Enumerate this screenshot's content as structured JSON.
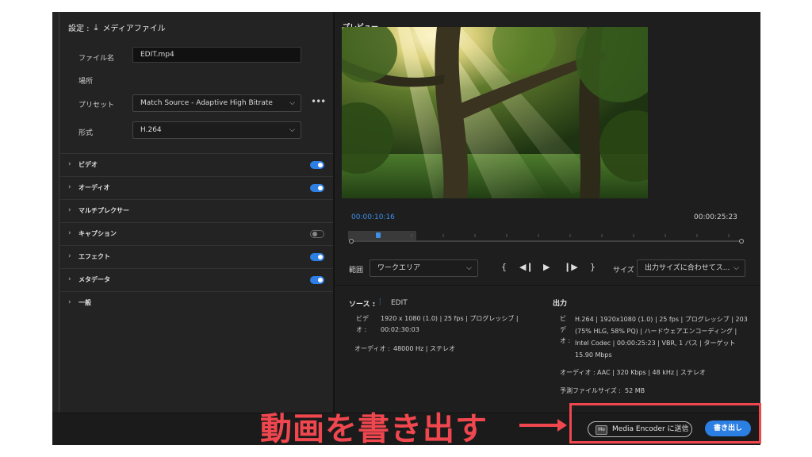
{
  "settings": {
    "header_label": "設定 :",
    "destination": "メディアファイル",
    "filename_label": "ファイル名",
    "filename_value": "EDIT.mp4",
    "location_label": "場所",
    "preset_label": "プリセット",
    "preset_value": "Match Source - Adaptive High Bitrate",
    "format_label": "形式",
    "format_value": "H.264",
    "sections": [
      {
        "label": "ビデオ",
        "toggle": true
      },
      {
        "label": "オーディオ",
        "toggle": true
      },
      {
        "label": "マルチプレクサー",
        "toggle": null
      },
      {
        "label": "キャプション",
        "toggle": false
      },
      {
        "label": "エフェクト",
        "toggle": true
      },
      {
        "label": "メタデータ",
        "toggle": true
      },
      {
        "label": "一般",
        "toggle": null
      }
    ]
  },
  "preview": {
    "title": "プレビュー",
    "current_time": "00:00:10:16",
    "duration": "00:00:25:23",
    "playhead_fraction": 0.07,
    "range_label": "範囲",
    "range_value": "ワークエリア",
    "size_label": "サイズ",
    "size_value": "出力サイズに合わせてス..."
  },
  "source": {
    "label": "ソース :",
    "name": "EDIT",
    "video_label_1": "ビデ",
    "video_label_2": "オ :",
    "video_line1": "1920 x 1080 (1.0) | 25 fps | プログレッシブ |",
    "video_line2": "00:02:30:03",
    "audio_label": "オーディオ :",
    "audio_value": "48000 Hz | ステレオ"
  },
  "output": {
    "label": "出力",
    "video_label_1": "ビ",
    "video_label_2": "デ",
    "video_label_3": "オ :",
    "video_line1": "H.264 | 1920x1080 (1.0) | 25 fps | プログレッシブ | 203",
    "video_line2": "(75% HLG, 58% PQ) | ハードウェアエンコーディング |",
    "video_line3": "Intel Codec | 00:00:25:23 | VBR, 1 パス | ターゲット",
    "video_line4": "15.90 Mbps",
    "audio_label": "オーディオ :",
    "audio_value": "AAC | 320 Kbps | 48 kHz | ステレオ",
    "size_label": "予測ファイルサイズ :",
    "size_value": "52 MB"
  },
  "buttons": {
    "send_encoder": "Media Encoder に送信",
    "export": "書き出し"
  },
  "annotation": "動画を書き出す",
  "colors": {
    "accent": "#2b7ee2",
    "highlight": "#f0474f",
    "timecode": "#3d8fe8"
  }
}
